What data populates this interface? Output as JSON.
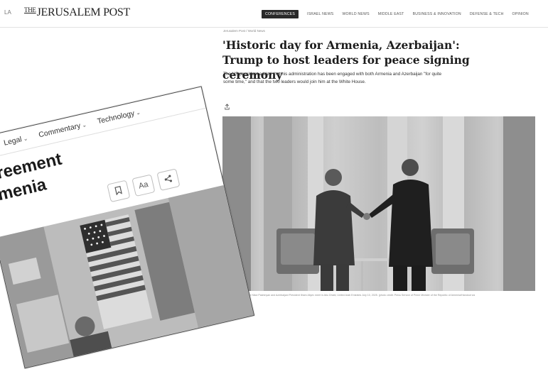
{
  "jpost": {
    "left_fragment": "LA",
    "logo_prefix": "THE",
    "logo_main": "JERUSALEM POST",
    "nav": [
      {
        "label": "CONFERENCES",
        "active": true
      },
      {
        "label": "ISRAEL NEWS",
        "active": false
      },
      {
        "label": "WORLD NEWS",
        "active": false
      },
      {
        "label": "MIDDLE EAST",
        "active": false
      },
      {
        "label": "BUSINESS & INNOVATION",
        "active": false
      },
      {
        "label": "DEFENSE & TECH",
        "active": false
      },
      {
        "label": "OPINION",
        "active": false
      }
    ],
    "breadcrumb": "Jerusalem Post / World News",
    "headline": "'Historic day for Armenia, Azerbaijan': Trump to host leaders for peace signing ceremony",
    "summary": "The US president added that his administration has been engaged with both Armenia and Azerbaijan \"for quite some time,\" and that the two leaders would join him at the White House.",
    "share_icon": "share-icon",
    "caption": "Armenian Prime Minister Nikol Pashinyan and Azerbaijani President Ilham Aliyev meet in Abu Dhabi, United Arab Emirates July 10, 2025. (photo credit: Press Service of Prime Minister of the Republic of Armenia/Handout via REUTERS)"
  },
  "front": {
    "nav": [
      {
        "label": "Legal"
      },
      {
        "label": "Commentary"
      },
      {
        "label": "Technology"
      }
    ],
    "headline": "greement\nrmenia",
    "tools": {
      "bookmark_icon": "bookmark-icon",
      "text_size_label": "Aa",
      "share_icon": "share-icon"
    }
  },
  "colors": {
    "nav_active_bg": "#2a2a2a",
    "page_bg": "#ffffff"
  }
}
